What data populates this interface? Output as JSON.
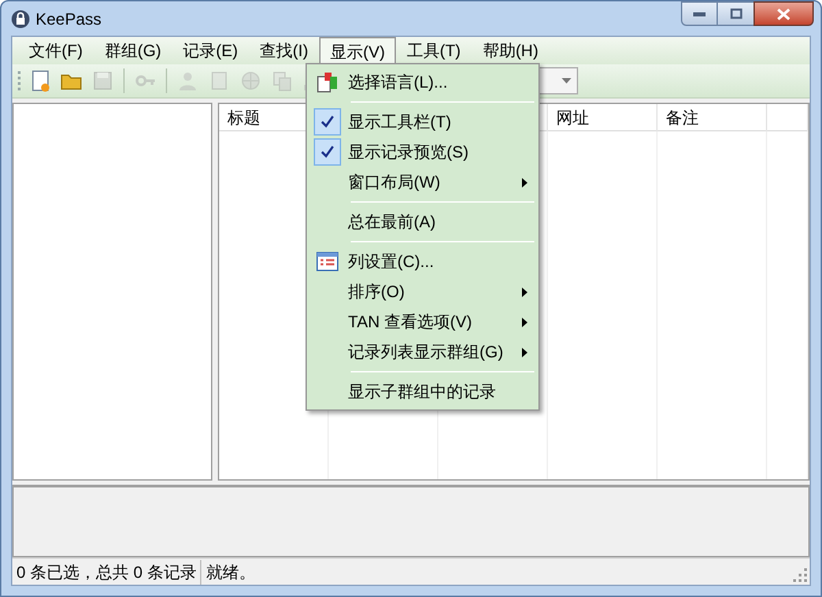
{
  "window": {
    "title": "KeePass"
  },
  "menu_bar": [
    {
      "label": "文件(F)",
      "selected": false
    },
    {
      "label": "群组(G)",
      "selected": false
    },
    {
      "label": "记录(E)",
      "selected": false
    },
    {
      "label": "查找(I)",
      "selected": false
    },
    {
      "label": "显示(V)",
      "selected": true
    },
    {
      "label": "工具(T)",
      "selected": false
    },
    {
      "label": "帮助(H)",
      "selected": false
    }
  ],
  "toolbar": [
    {
      "kind": "new",
      "disabled": false
    },
    {
      "kind": "open",
      "disabled": false
    },
    {
      "kind": "save",
      "disabled": true
    },
    {
      "kind": "sep"
    },
    {
      "kind": "key",
      "disabled": true
    },
    {
      "kind": "sep"
    },
    {
      "kind": "user",
      "disabled": true
    },
    {
      "kind": "doc",
      "disabled": true
    },
    {
      "kind": "globe",
      "disabled": true
    },
    {
      "kind": "copy",
      "disabled": true
    },
    {
      "kind": "tree",
      "disabled": true
    }
  ],
  "table": {
    "columns": [
      "标题",
      "",
      "",
      "网址",
      "备注",
      ""
    ]
  },
  "view_menu": [
    {
      "kind": "language",
      "label": "选择语言(L)...",
      "checked": false
    },
    {
      "kind": "separator"
    },
    {
      "kind": "item",
      "label": "显示工具栏(T)",
      "checked": true
    },
    {
      "kind": "item",
      "label": "显示记录预览(S)",
      "checked": true
    },
    {
      "kind": "submenu",
      "label": "窗口布局(W)",
      "checked": false
    },
    {
      "kind": "separator"
    },
    {
      "kind": "item",
      "label": "总在最前(A)",
      "checked": false
    },
    {
      "kind": "separator"
    },
    {
      "kind": "columns",
      "label": "列设置(C)...",
      "checked": false
    },
    {
      "kind": "submenu",
      "label": "排序(O)",
      "checked": false
    },
    {
      "kind": "submenu",
      "label": "TAN 查看选项(V)",
      "checked": false
    },
    {
      "kind": "submenu",
      "label": "记录列表显示群组(G)",
      "checked": false
    },
    {
      "kind": "separator"
    },
    {
      "kind": "item",
      "label": "显示子群组中的记录",
      "checked": false
    }
  ],
  "status_bar": [
    "0 条已选，总共 0 条记录",
    "就绪。"
  ]
}
